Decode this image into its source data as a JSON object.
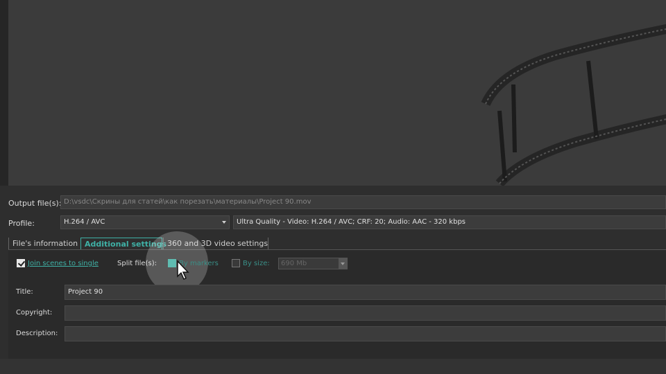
{
  "output": {
    "label": "Output file(s):",
    "value": "D:\\vsdc\\Скрины для статей\\как порезать\\материалы\\Project 90.mov"
  },
  "profile": {
    "label": "Profile:",
    "value": "H.264 / AVC",
    "quality": "Ultra Quality - Video: H.264 / AVC; CRF: 20; Audio: AAC - 320 kbps"
  },
  "tabs": [
    {
      "label": "File's information"
    },
    {
      "label": "Additional settings"
    },
    {
      "label": "360 and 3D video settings"
    }
  ],
  "options": {
    "join_scenes": {
      "label": "Join scenes to single",
      "checked": true
    },
    "split_label": "Split file(s):",
    "by_markers": {
      "label": "By markers",
      "checked": true
    },
    "by_size": {
      "label": "By size:",
      "checked": false,
      "value": "690 Mb"
    }
  },
  "metadata": {
    "title_label": "Title:",
    "title_value": "Project 90",
    "copyright_label": "Copyright:",
    "copyright_value": "",
    "description_label": "Description:",
    "description_value": ""
  },
  "colors": {
    "accent": "#3fb1a6",
    "background": "#2e2e2e"
  }
}
